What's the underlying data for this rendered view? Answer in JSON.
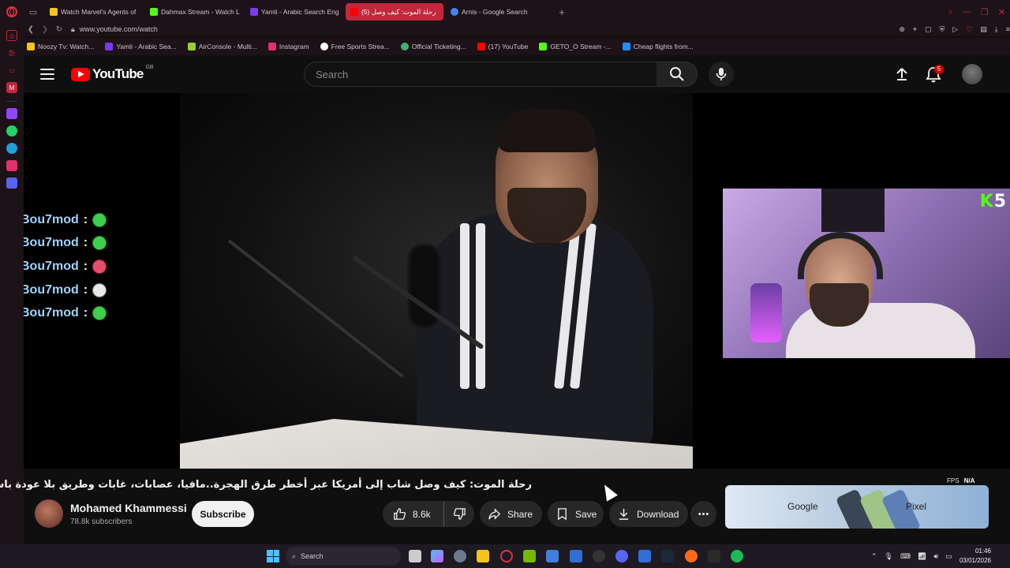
{
  "browser": {
    "tabs": [
      {
        "label": "Watch Marvel's Agents of",
        "color": "#f5c518"
      },
      {
        "label": "Dahmax Stream - Watch L",
        "color": "#53fc18"
      },
      {
        "label": "Yamli - Arabic Search Eng",
        "color": "#7c3aed"
      },
      {
        "label": "(5) رحلة الموت: كيف وصل",
        "color": "#ff0000",
        "active": true
      },
      {
        "label": "Arnis - Google Search",
        "color": "#4285f4"
      }
    ],
    "url": "www.youtube.com/watch",
    "bookmarks": [
      {
        "label": "Noozy Tv: Watch...",
        "color": "#f5c518"
      },
      {
        "label": "Yamli - Arabic Sea...",
        "color": "#7c3aed"
      },
      {
        "label": "AirConsole - Multi...",
        "color": "#9acd32"
      },
      {
        "label": "Instagram",
        "color": "#e1306c"
      },
      {
        "label": "Free Sports Strea...",
        "color": "#ffffff"
      },
      {
        "label": "Official Ticketing...",
        "color": "#3cb371"
      },
      {
        "label": "(17) YouTube",
        "color": "#ff0000"
      },
      {
        "label": "GETO_O Stream -...",
        "color": "#53fc18"
      },
      {
        "label": "Cheap flights from...",
        "color": "#1e90ff"
      }
    ]
  },
  "youtube": {
    "logo_text": "YouTube",
    "region": "GB",
    "search_placeholder": "Search",
    "notification_count": "5",
    "video": {
      "title": "رحلة الموت: كيف وصل شاب إلى أمريكا عبر أخطر طرق الهجرة..مافيا، عصابات، غابات وطريق بلا عودة باسم الحب",
      "channel_name": "Mohamed Khammessi",
      "subscribers": "78.8k subscribers",
      "subscribe_label": "Subscribe",
      "likes": "8.6k",
      "share_label": "Share",
      "save_label": "Save",
      "download_label": "Download"
    },
    "chat": [
      {
        "user": "Bou7mod"
      },
      {
        "user": "Bou7mod"
      },
      {
        "user": "Bou7mod"
      },
      {
        "user": "Bou7mod"
      },
      {
        "user": "Bou7mod"
      }
    ],
    "ad": {
      "brand": "Google",
      "product": "Pixel"
    }
  },
  "overlay": {
    "fps_label": "FPS",
    "fps_value": "N/A"
  },
  "taskbar": {
    "search_label": "Search",
    "time": "01:46",
    "date": "03/01/2026"
  },
  "colors": {
    "accent": "#ff0000",
    "opera": "#c2273c",
    "kick_green": "#53fc18"
  }
}
